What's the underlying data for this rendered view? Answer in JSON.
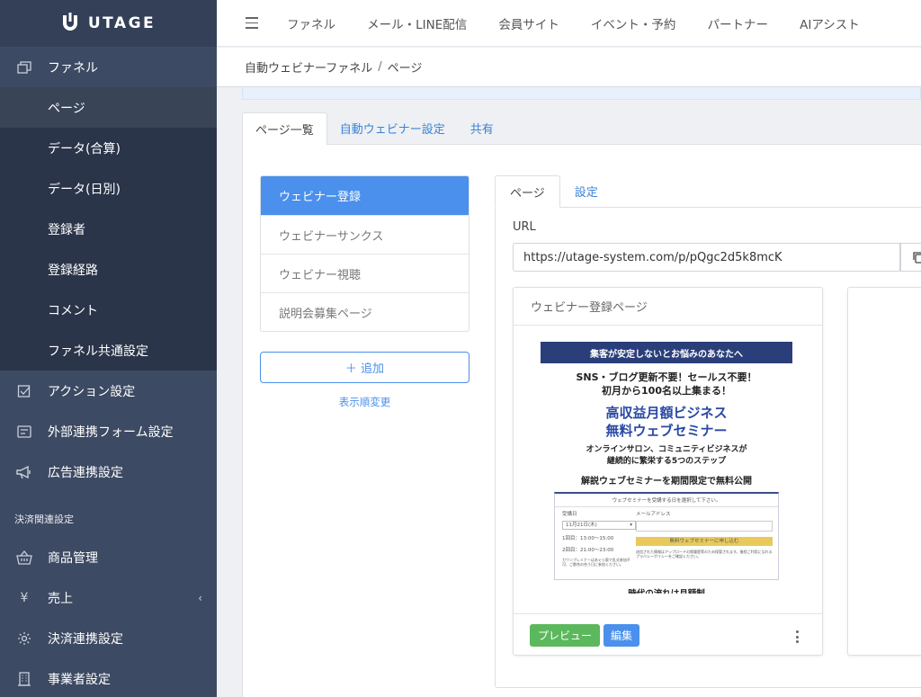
{
  "app": {
    "logo_text": "UTAGE"
  },
  "sidebar": {
    "funnel_label": "ファネル",
    "funnel_subitems": [
      "ページ",
      "データ(合算)",
      "データ(日別)",
      "登録者",
      "登録経路",
      "コメント",
      "ファネル共通設定"
    ],
    "items": [
      {
        "label": "アクション設定",
        "icon": "checkbox-icon"
      },
      {
        "label": "外部連携フォーム設定",
        "icon": "form-icon"
      },
      {
        "label": "広告連携設定",
        "icon": "megaphone-icon"
      }
    ],
    "payment_section_label": "決済関連設定",
    "payment_items": [
      {
        "label": "商品管理",
        "icon": "basket-icon"
      },
      {
        "label": "売上",
        "icon": "yen-icon",
        "yen_glyph": "¥",
        "chevron": "‹"
      },
      {
        "label": "決済連携設定",
        "icon": "gear-icon"
      },
      {
        "label": "事業者設定",
        "icon": "building-icon"
      }
    ]
  },
  "topnav": [
    "ファネル",
    "メール・LINE配信",
    "会員サイト",
    "イベント・予約",
    "パートナー",
    "AIアシスト"
  ],
  "breadcrumb": {
    "parent": "自動ウェビナーファネル",
    "sep": "/",
    "current": "ページ"
  },
  "tabs": [
    "ページ一覧",
    "自動ウェビナー設定",
    "共有"
  ],
  "page_list": [
    "ウェビナー登録",
    "ウェビナーサンクス",
    "ウェビナー視聴",
    "説明会募集ページ"
  ],
  "add_button": "＋ 追加",
  "reorder_link": "表示順変更",
  "subtabs": [
    "ページ",
    "設定"
  ],
  "url": {
    "label": "URL",
    "value": "https://utage-system.com/p/pQgc2d5k8mcK"
  },
  "preview_card": {
    "title": "ウェビナー登録ページ",
    "preview_button": "プレビュー",
    "edit_button": "編集"
  },
  "thumbnail": {
    "banner": "集客が安定しないとお悩みのあなたへ",
    "line1": "SNS・ブログ更新不要！セールス不要！",
    "line2": "初月から100名以上集まる！",
    "headline1": "高収益月額ビジネス",
    "headline2": "無料ウェブセミナー",
    "sub1": "オンラインサロン、コミュニティビジネスが",
    "sub2": "継続的に繁栄する5つのステップ",
    "cta_line": "解説ウェブセミナーを期間限定で無料公開",
    "form_header": "ウェブセミナーを受講する日を選択して下さい。",
    "date_label": "受講日",
    "date_value": "11月21日(木)",
    "date_caret": "▾",
    "slot1": "1回目：13:00〜15:00",
    "slot2": "2回目：21:00〜23:00",
    "note": "カウンプレミナーはあぐら版で乱式参加不可、ご都合の合う日に参加ください。",
    "email_label": "メールアドレス",
    "submit": "無料ウェブセミナーに申し込む",
    "disclaimer": "送信された情報はアップロードの際履歴等のため保管されます。後程ご利用になれるプラバシーポリシーをご確認ください。",
    "footer": "時代の流れは月額制"
  }
}
